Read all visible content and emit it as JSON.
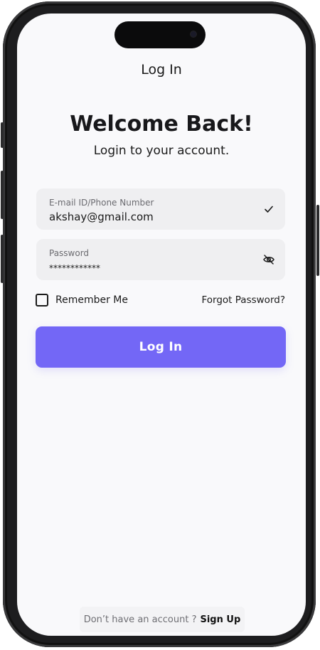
{
  "header": {
    "title": "Log In"
  },
  "welcome": {
    "heading": "Welcome Back!",
    "subheading": "Login to your account."
  },
  "form": {
    "email": {
      "label": "E-mail ID/Phone Number",
      "value": "akshay@gmail.com",
      "icon": "checkmark-icon"
    },
    "password": {
      "label": "Password",
      "value": "************",
      "icon": "eye-off-icon"
    },
    "remember_me": {
      "label": "Remember Me",
      "checked": false
    },
    "forgot_password": "Forgot Password?",
    "submit_label": "Log In"
  },
  "footer": {
    "prompt": "Don’t  have an account ?",
    "signup_link": "Sign Up"
  },
  "colors": {
    "primary": "#7367f6",
    "field_bg": "#efeff1",
    "screen_bg": "#f9f9fb"
  }
}
